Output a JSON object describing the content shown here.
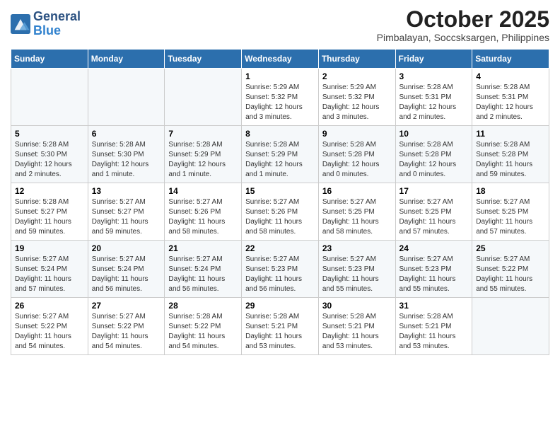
{
  "header": {
    "logo_line1": "General",
    "logo_line2": "Blue",
    "title": "October 2025",
    "subtitle": "Pimbalayan, Soccsksargen, Philippines"
  },
  "weekdays": [
    "Sunday",
    "Monday",
    "Tuesday",
    "Wednesday",
    "Thursday",
    "Friday",
    "Saturday"
  ],
  "weeks": [
    [
      {
        "day": "",
        "info": ""
      },
      {
        "day": "",
        "info": ""
      },
      {
        "day": "",
        "info": ""
      },
      {
        "day": "1",
        "info": "Sunrise: 5:29 AM\nSunset: 5:32 PM\nDaylight: 12 hours and 3 minutes."
      },
      {
        "day": "2",
        "info": "Sunrise: 5:29 AM\nSunset: 5:32 PM\nDaylight: 12 hours and 3 minutes."
      },
      {
        "day": "3",
        "info": "Sunrise: 5:28 AM\nSunset: 5:31 PM\nDaylight: 12 hours and 2 minutes."
      },
      {
        "day": "4",
        "info": "Sunrise: 5:28 AM\nSunset: 5:31 PM\nDaylight: 12 hours and 2 minutes."
      }
    ],
    [
      {
        "day": "5",
        "info": "Sunrise: 5:28 AM\nSunset: 5:30 PM\nDaylight: 12 hours and 2 minutes."
      },
      {
        "day": "6",
        "info": "Sunrise: 5:28 AM\nSunset: 5:30 PM\nDaylight: 12 hours and 1 minute."
      },
      {
        "day": "7",
        "info": "Sunrise: 5:28 AM\nSunset: 5:29 PM\nDaylight: 12 hours and 1 minute."
      },
      {
        "day": "8",
        "info": "Sunrise: 5:28 AM\nSunset: 5:29 PM\nDaylight: 12 hours and 1 minute."
      },
      {
        "day": "9",
        "info": "Sunrise: 5:28 AM\nSunset: 5:28 PM\nDaylight: 12 hours and 0 minutes."
      },
      {
        "day": "10",
        "info": "Sunrise: 5:28 AM\nSunset: 5:28 PM\nDaylight: 12 hours and 0 minutes."
      },
      {
        "day": "11",
        "info": "Sunrise: 5:28 AM\nSunset: 5:28 PM\nDaylight: 11 hours and 59 minutes."
      }
    ],
    [
      {
        "day": "12",
        "info": "Sunrise: 5:28 AM\nSunset: 5:27 PM\nDaylight: 11 hours and 59 minutes."
      },
      {
        "day": "13",
        "info": "Sunrise: 5:27 AM\nSunset: 5:27 PM\nDaylight: 11 hours and 59 minutes."
      },
      {
        "day": "14",
        "info": "Sunrise: 5:27 AM\nSunset: 5:26 PM\nDaylight: 11 hours and 58 minutes."
      },
      {
        "day": "15",
        "info": "Sunrise: 5:27 AM\nSunset: 5:26 PM\nDaylight: 11 hours and 58 minutes."
      },
      {
        "day": "16",
        "info": "Sunrise: 5:27 AM\nSunset: 5:25 PM\nDaylight: 11 hours and 58 minutes."
      },
      {
        "day": "17",
        "info": "Sunrise: 5:27 AM\nSunset: 5:25 PM\nDaylight: 11 hours and 57 minutes."
      },
      {
        "day": "18",
        "info": "Sunrise: 5:27 AM\nSunset: 5:25 PM\nDaylight: 11 hours and 57 minutes."
      }
    ],
    [
      {
        "day": "19",
        "info": "Sunrise: 5:27 AM\nSunset: 5:24 PM\nDaylight: 11 hours and 57 minutes."
      },
      {
        "day": "20",
        "info": "Sunrise: 5:27 AM\nSunset: 5:24 PM\nDaylight: 11 hours and 56 minutes."
      },
      {
        "day": "21",
        "info": "Sunrise: 5:27 AM\nSunset: 5:24 PM\nDaylight: 11 hours and 56 minutes."
      },
      {
        "day": "22",
        "info": "Sunrise: 5:27 AM\nSunset: 5:23 PM\nDaylight: 11 hours and 56 minutes."
      },
      {
        "day": "23",
        "info": "Sunrise: 5:27 AM\nSunset: 5:23 PM\nDaylight: 11 hours and 55 minutes."
      },
      {
        "day": "24",
        "info": "Sunrise: 5:27 AM\nSunset: 5:23 PM\nDaylight: 11 hours and 55 minutes."
      },
      {
        "day": "25",
        "info": "Sunrise: 5:27 AM\nSunset: 5:22 PM\nDaylight: 11 hours and 55 minutes."
      }
    ],
    [
      {
        "day": "26",
        "info": "Sunrise: 5:27 AM\nSunset: 5:22 PM\nDaylight: 11 hours and 54 minutes."
      },
      {
        "day": "27",
        "info": "Sunrise: 5:27 AM\nSunset: 5:22 PM\nDaylight: 11 hours and 54 minutes."
      },
      {
        "day": "28",
        "info": "Sunrise: 5:28 AM\nSunset: 5:22 PM\nDaylight: 11 hours and 54 minutes."
      },
      {
        "day": "29",
        "info": "Sunrise: 5:28 AM\nSunset: 5:21 PM\nDaylight: 11 hours and 53 minutes."
      },
      {
        "day": "30",
        "info": "Sunrise: 5:28 AM\nSunset: 5:21 PM\nDaylight: 11 hours and 53 minutes."
      },
      {
        "day": "31",
        "info": "Sunrise: 5:28 AM\nSunset: 5:21 PM\nDaylight: 11 hours and 53 minutes."
      },
      {
        "day": "",
        "info": ""
      }
    ]
  ]
}
